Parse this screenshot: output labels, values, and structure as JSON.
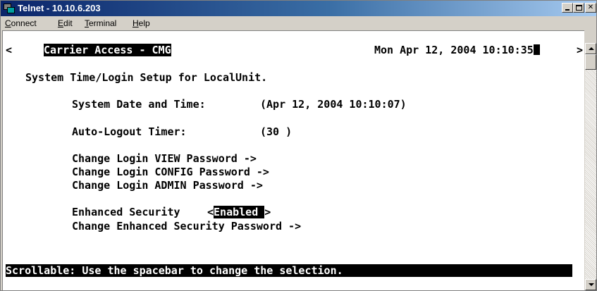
{
  "window": {
    "title": "Telnet - 10.10.6.203"
  },
  "menu": {
    "connect": {
      "hotkey": "C",
      "rest": "onnect"
    },
    "edit": {
      "hotkey": "E",
      "rest": "dit"
    },
    "terminal": {
      "hotkey": "T",
      "rest": "erminal"
    },
    "help": {
      "hotkey": "H",
      "rest": "elp"
    }
  },
  "terminal": {
    "left_arrow": "<",
    "right_arrow": ">",
    "header_title": "Carrier Access - CMG",
    "header_datetime": "Mon Apr 12, 2004 10:10:35",
    "screen_title": "System Time/Login Setup for LocalUnit.",
    "date_time_label": "System Date and Time:",
    "date_time_value": "(Apr 12, 2004 10:10:07)",
    "auto_logout_label": "Auto-Logout Timer:",
    "auto_logout_value": "(30 )",
    "view_password": "Change Login VIEW Password ->",
    "config_password": "Change Login CONFIG Password ->",
    "admin_password": "Change Login ADMIN Password ->",
    "enhanced_security_label": "Enhanced Security",
    "enhanced_security_open": "<",
    "enhanced_security_value": "Enabled ",
    "enhanced_security_close": ">",
    "enhanced_security_password": "Change Enhanced Security Password ->",
    "status_line": "Scrollable: Use the spacebar to change the selection."
  },
  "colors": {
    "title_bar_start": "#0a246a",
    "title_bar_end": "#a6caf0",
    "chrome": "#d4d0c8",
    "terminal_bg": "#ffffff",
    "terminal_fg": "#000000"
  },
  "icons": {
    "app": "telnet-computers-icon",
    "minimize": "minimize-icon",
    "maximize": "maximize-icon",
    "close": "close-icon",
    "scroll_up": "scroll-up-arrow-icon",
    "scroll_down": "scroll-down-arrow-icon"
  }
}
